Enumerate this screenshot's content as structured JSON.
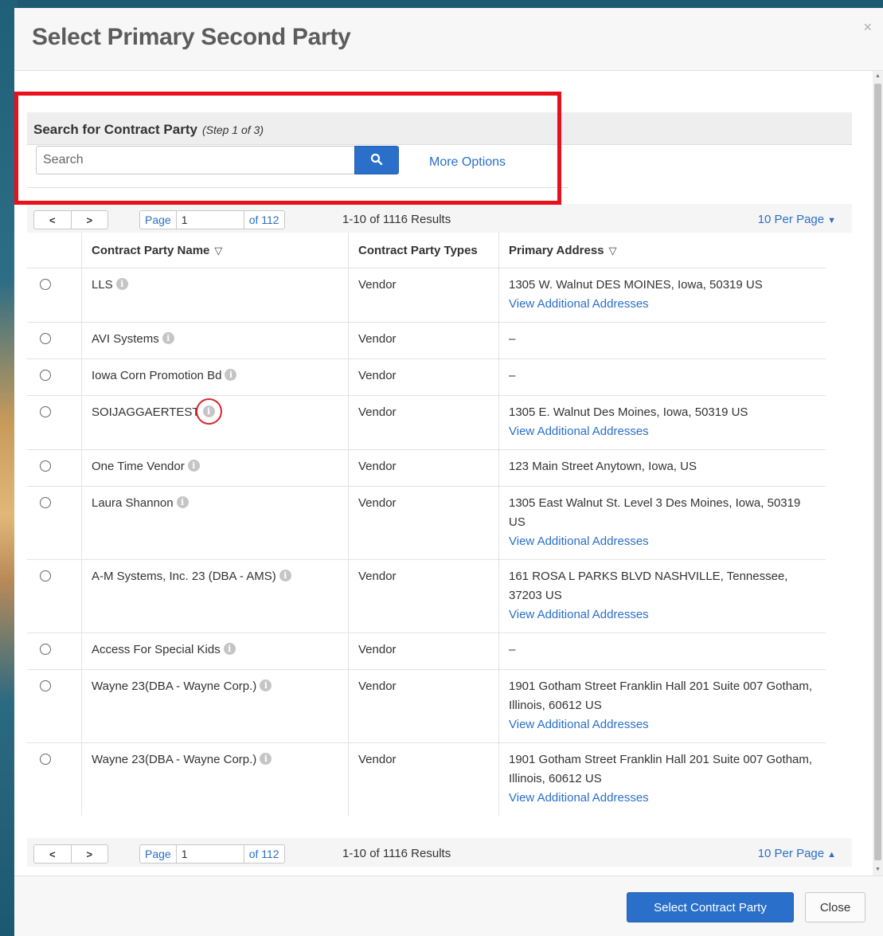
{
  "modal": {
    "title": "Select Primary Second Party",
    "close_glyph": "×"
  },
  "search": {
    "heading": "Search for Contract Party",
    "step": "(Step 1 of 3)",
    "placeholder": "Search",
    "value": "",
    "more_options": "More Options"
  },
  "pager": {
    "prev": "<",
    "next": ">",
    "page_label": "Page",
    "page_value": "1",
    "of_label": "of 112",
    "results": "1-10 of 1116 Results",
    "per_page": "10 Per Page",
    "caret_down": "▼",
    "caret_up": "▲"
  },
  "table": {
    "columns": [
      "Contract Party Name",
      "Contract Party Types",
      "Primary Address"
    ],
    "sort_glyph": "▽",
    "view_more_label": "View Additional Addresses",
    "rows": [
      {
        "name": "LLS",
        "type": "Vendor",
        "address": "1305 W. Walnut DES MOINES, Iowa, 50319 US",
        "link": "View Additional Addresses"
      },
      {
        "name": "AVI Systems",
        "type": "Vendor",
        "address": "–",
        "link": ""
      },
      {
        "name": "Iowa Corn Promotion Bd",
        "type": "Vendor",
        "address": "–",
        "link": ""
      },
      {
        "name": "SOIJAGGAERTEST",
        "type": "Vendor",
        "address": "1305 E. Walnut Des Moines, Iowa, 50319 US",
        "link": "View Additional Addresses"
      },
      {
        "name": "One Time Vendor",
        "type": "Vendor",
        "address": "123 Main Street Anytown, Iowa, US",
        "link": ""
      },
      {
        "name": "Laura Shannon",
        "type": "Vendor",
        "address": "1305 East Walnut St. Level 3 Des Moines, Iowa, 50319 US",
        "link": "View Additional Addresses"
      },
      {
        "name": "A-M Systems, Inc. 23 (DBA - AMS)",
        "type": "Vendor",
        "address": "161 ROSA L PARKS BLVD NASHVILLE, Tennessee, 37203 US",
        "link": "View Additional Addresses"
      },
      {
        "name": "Access For Special Kids",
        "type": "Vendor",
        "address": "–",
        "link": ""
      },
      {
        "name": "Wayne 23(DBA - Wayne Corp.)",
        "type": "Vendor",
        "address": "1901 Gotham Street Franklin Hall 201 Suite 007 Gotham, Illinois, 60612 US",
        "link": "View Additional Addresses"
      },
      {
        "name": "Wayne 23(DBA - Wayne Corp.)",
        "type": "Vendor",
        "address": "1901 Gotham Street Franklin Hall 201 Suite 007 Gotham, Illinois, 60612 US",
        "link": "View Additional Addresses"
      }
    ]
  },
  "footer": {
    "select_label": "Select Contract Party",
    "close_label": "Close"
  },
  "colors": {
    "accent": "#2a6fc9",
    "highlight": "#e8101a",
    "backdrop": "#1d5a72"
  },
  "icons": [
    "search-icon",
    "info-icon",
    "close-icon",
    "sort-icon",
    "caret-down-icon",
    "caret-up-icon"
  ]
}
